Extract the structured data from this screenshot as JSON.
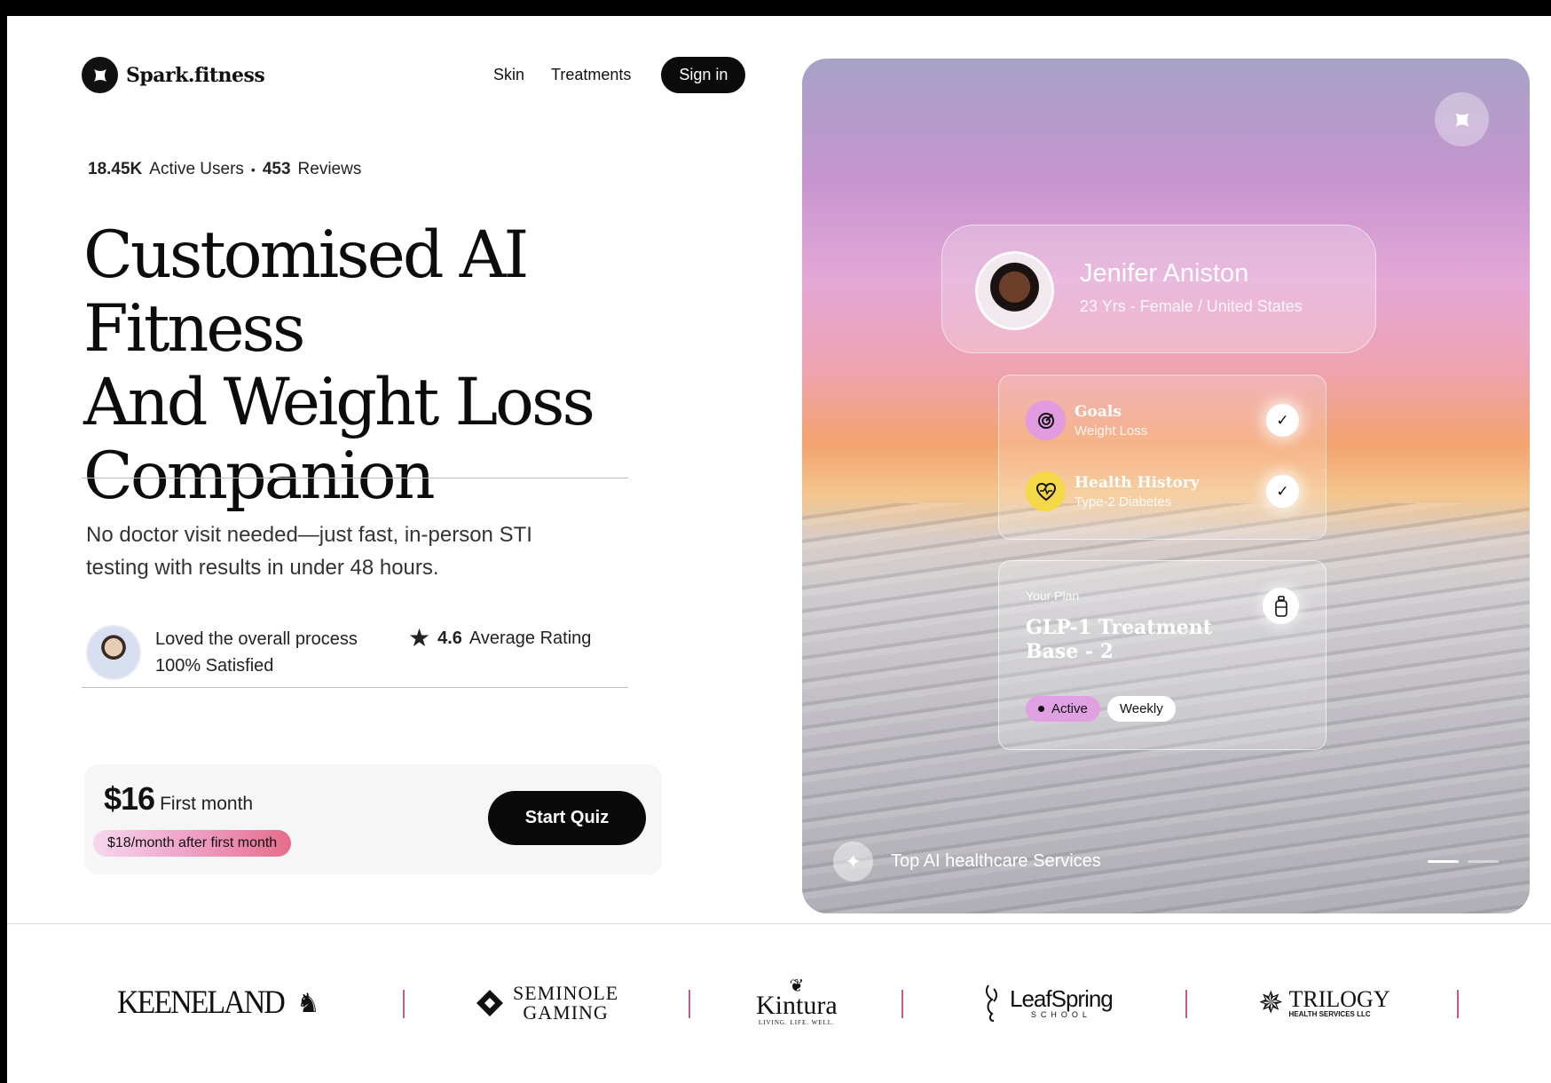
{
  "brand": {
    "name": "Spark.fitness",
    "icon": "sparkle-logo-icon"
  },
  "nav": {
    "links": [
      "Skin",
      "Treatments"
    ],
    "signin_label": "Sign in"
  },
  "stats": {
    "users_value": "18.45K",
    "users_label": "Active Users",
    "separator": "•",
    "reviews_value": "453",
    "reviews_label": "Reviews"
  },
  "headline": {
    "lines": [
      "Customised AI Fitness",
      "And Weight Loss",
      "Companion"
    ]
  },
  "subtext": "No doctor visit needed—just fast, in-person STI testing with results in under 48 hours.",
  "review": {
    "line1": "Loved the overall process",
    "line2": "100% Satisfied"
  },
  "rating": {
    "value": "4.6",
    "label": "Average Rating",
    "icon": "star-icon"
  },
  "pricing": {
    "amount": "$16",
    "period": "First month",
    "after_note": "$18/month after first month",
    "cta_label": "Start Quiz"
  },
  "hero": {
    "profile": {
      "name": "Jenifer Aniston",
      "details": "23 Yrs - Female / United States"
    },
    "checklist": [
      {
        "title": "Goals",
        "value": "Weight Loss",
        "icon": "target-icon",
        "color": "#e39be0"
      },
      {
        "title": "Health History",
        "value": "Type-2 Diabetes",
        "icon": "heart-pulse-icon",
        "color": "#f5d848"
      }
    ],
    "plan": {
      "label": "Your Plan",
      "title": "GLP-1 Treatment Base - 2",
      "status": "Active",
      "frequency": "Weekly",
      "icon": "bottle-icon"
    },
    "footer_text": "Top AI healthcare Services",
    "carousel": {
      "current": 1,
      "total": 2
    }
  },
  "partners": {
    "keeneland": "KEENELAND",
    "seminole": [
      "SEMINOLE",
      "GAMING"
    ],
    "kintura": {
      "name": "Kintura",
      "tagline": "LIVING. LIFE. WELL."
    },
    "leafspring": {
      "name": "LeafSpring",
      "tagline": "SCHOOL"
    },
    "trilogy": {
      "name": "TRILOGY",
      "tagline": "HEALTH SERVICES LLC"
    }
  }
}
